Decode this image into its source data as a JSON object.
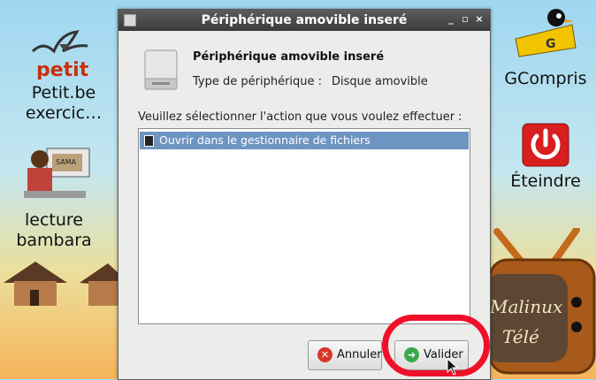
{
  "desktop": {
    "petit_label": "Petit.be exercic…",
    "petit_logo": "petit",
    "lecture_label": "lecture bambara",
    "sama_tag": "SAMA",
    "gcompris_label": "GCompris",
    "gcompris_tag": "G",
    "eteindre_label": "Éteindre",
    "tele_line1": "Malinux",
    "tele_line2": "Télé"
  },
  "dialog": {
    "title": "Périphérique amovible inseré",
    "heading": "Périphérique amovible inseré",
    "type_label": "Type de périphérique :",
    "type_value": "Disque amovible",
    "prompt": "Veuillez sélectionner l'action que vous voulez effectuer :",
    "actions": [
      {
        "label": "Ouvrir dans le gestionnaire de fichiers",
        "icon": "file-manager-icon",
        "selected": true
      }
    ],
    "cancel_label": "Annuler",
    "ok_label": "Valider",
    "titlebar_controls": [
      "_",
      "▫",
      "×"
    ]
  }
}
